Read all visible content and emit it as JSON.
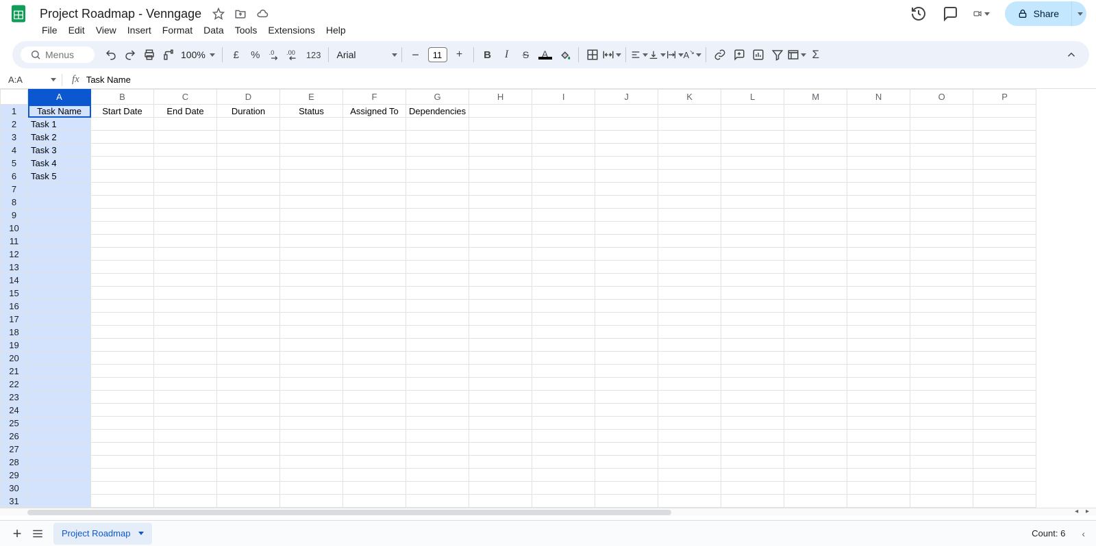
{
  "doc": {
    "title": "Project Roadmap - Venngage"
  },
  "menus": [
    "File",
    "Edit",
    "View",
    "Insert",
    "Format",
    "Data",
    "Tools",
    "Extensions",
    "Help"
  ],
  "toolbar": {
    "search_placeholder": "Menus",
    "zoom": "100%",
    "currency": "£",
    "percent": "%",
    "format123": "123",
    "font": "Arial",
    "font_size": "11"
  },
  "share": {
    "label": "Share"
  },
  "namebox": "A:A",
  "formula": "Task Name",
  "columns": [
    "A",
    "B",
    "C",
    "D",
    "E",
    "F",
    "G",
    "H",
    "I",
    "J",
    "K",
    "L",
    "M",
    "N",
    "O",
    "P"
  ],
  "row_count": 31,
  "headers_row": [
    "Task Name",
    "Start Date",
    "End Date",
    "Duration",
    "Status",
    "Assigned To",
    "Dependencies"
  ],
  "data_rows": [
    [
      "Task 1",
      "",
      "",
      "",
      "",
      "",
      ""
    ],
    [
      "Task 2",
      "",
      "",
      "",
      "",
      "",
      ""
    ],
    [
      "Task 3",
      "",
      "",
      "",
      "",
      "",
      ""
    ],
    [
      "Task 4",
      "",
      "",
      "",
      "",
      "",
      ""
    ],
    [
      "Task 5",
      "",
      "",
      "",
      "",
      "",
      ""
    ]
  ],
  "sheet_tab": "Project Roadmap",
  "status": {
    "count_label": "Count: 6"
  }
}
